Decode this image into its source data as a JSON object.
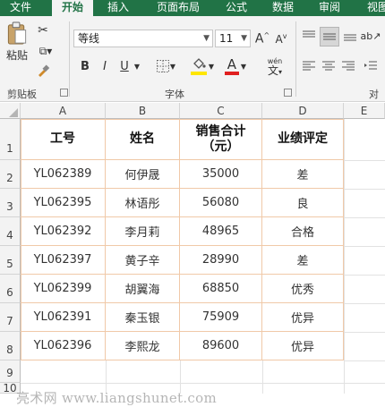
{
  "tabs": [
    "文件",
    "开始",
    "插入",
    "页面布局",
    "公式",
    "数据",
    "审阅",
    "视图"
  ],
  "ribbon": {
    "clipboard": {
      "paste_label": "粘贴",
      "group_label": "剪贴板"
    },
    "font": {
      "font_name": "等线",
      "font_size": "11",
      "group_label": "字体",
      "bold": "B",
      "italic": "I",
      "underline": "U",
      "grow": "A",
      "shrink": "A",
      "font_color_letter": "A",
      "phonetic": "wén"
    },
    "alignment": {
      "group_label": "对"
    }
  },
  "columns": [
    "A",
    "B",
    "C",
    "D",
    "E"
  ],
  "rows": [
    "1",
    "2",
    "3",
    "4",
    "5",
    "6",
    "7",
    "8",
    "9",
    "10"
  ],
  "table": {
    "headers": [
      "工号",
      "姓名",
      "销售合计\n（元）",
      "业绩评定"
    ],
    "rows": [
      [
        "YL062389",
        "何伊晟",
        "35000",
        "差"
      ],
      [
        "YL062395",
        "林语彤",
        "56080",
        "良"
      ],
      [
        "YL062392",
        "李月莉",
        "48965",
        "合格"
      ],
      [
        "YL062397",
        "黄子辛",
        "28990",
        "差"
      ],
      [
        "YL062399",
        "胡翼海",
        "68850",
        "优秀"
      ],
      [
        "YL062391",
        "秦玉银",
        "75909",
        "优异"
      ],
      [
        "YL062396",
        "李熙龙",
        "89600",
        "优异"
      ]
    ]
  },
  "watermark": "亮术网 www.liangshunet.com",
  "colors": {
    "accent": "#217346",
    "table_border": "#f0c9a8",
    "font_color_bar": "#e02020",
    "highlight_bar": "#ffe600"
  }
}
